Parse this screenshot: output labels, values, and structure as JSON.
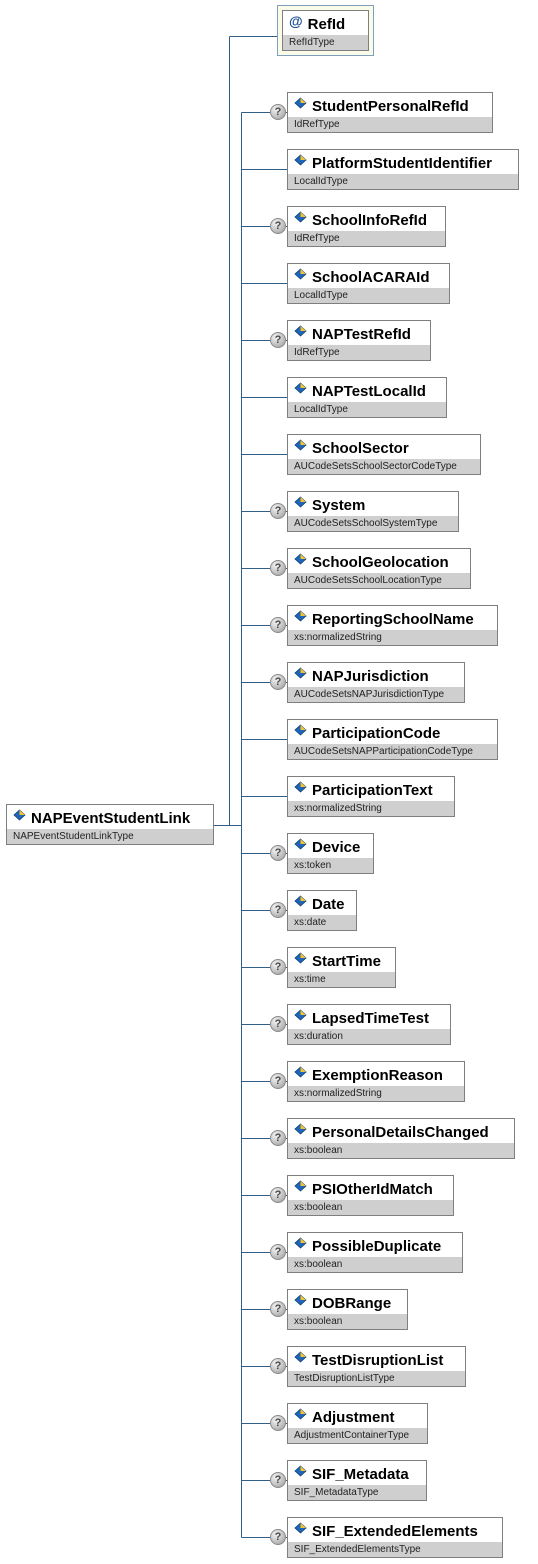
{
  "root": {
    "name": "NAPEventStudentLink",
    "type": "NAPEventStudentLinkType",
    "icon": "element-icon"
  },
  "attribute": {
    "name": "RefId",
    "type": "RefIdType",
    "icon": "attribute-icon",
    "symbol": "@"
  },
  "optional_marker": "?",
  "children": [
    {
      "name": "StudentPersonalRefId",
      "type": "IdRefType",
      "optional": true
    },
    {
      "name": "PlatformStudentIdentifier",
      "type": "LocalIdType",
      "optional": false
    },
    {
      "name": "SchoolInfoRefId",
      "type": "IdRefType",
      "optional": true
    },
    {
      "name": "SchoolACARAId",
      "type": "LocalIdType",
      "optional": false
    },
    {
      "name": "NAPTestRefId",
      "type": "IdRefType",
      "optional": true
    },
    {
      "name": "NAPTestLocalId",
      "type": "LocalIdType",
      "optional": false
    },
    {
      "name": "SchoolSector",
      "type": "AUCodeSetsSchoolSectorCodeType",
      "optional": false
    },
    {
      "name": "System",
      "type": "AUCodeSetsSchoolSystemType",
      "optional": true
    },
    {
      "name": "SchoolGeolocation",
      "type": "AUCodeSetsSchoolLocationType",
      "optional": true
    },
    {
      "name": "ReportingSchoolName",
      "type": "xs:normalizedString",
      "optional": true
    },
    {
      "name": "NAPJurisdiction",
      "type": "AUCodeSetsNAPJurisdictionType",
      "optional": true
    },
    {
      "name": "ParticipationCode",
      "type": "AUCodeSetsNAPParticipationCodeType",
      "optional": false
    },
    {
      "name": "ParticipationText",
      "type": "xs:normalizedString",
      "optional": false
    },
    {
      "name": "Device",
      "type": "xs:token",
      "optional": true
    },
    {
      "name": "Date",
      "type": "xs:date",
      "optional": true
    },
    {
      "name": "StartTime",
      "type": "xs:time",
      "optional": true
    },
    {
      "name": "LapsedTimeTest",
      "type": "xs:duration",
      "optional": true
    },
    {
      "name": "ExemptionReason",
      "type": "xs:normalizedString",
      "optional": true
    },
    {
      "name": "PersonalDetailsChanged",
      "type": "xs:boolean",
      "optional": true
    },
    {
      "name": "PSIOtherIdMatch",
      "type": "xs:boolean",
      "optional": true
    },
    {
      "name": "PossibleDuplicate",
      "type": "xs:boolean",
      "optional": true
    },
    {
      "name": "DOBRange",
      "type": "xs:boolean",
      "optional": true
    },
    {
      "name": "TestDisruptionList",
      "type": "TestDisruptionListType",
      "optional": true
    },
    {
      "name": "Adjustment",
      "type": "AdjustmentContainerType",
      "optional": true
    },
    {
      "name": "SIF_Metadata",
      "type": "SIF_MetadataType",
      "optional": true
    },
    {
      "name": "SIF_ExtendedElements",
      "type": "SIF_ExtendedElementsType",
      "optional": true
    }
  ]
}
